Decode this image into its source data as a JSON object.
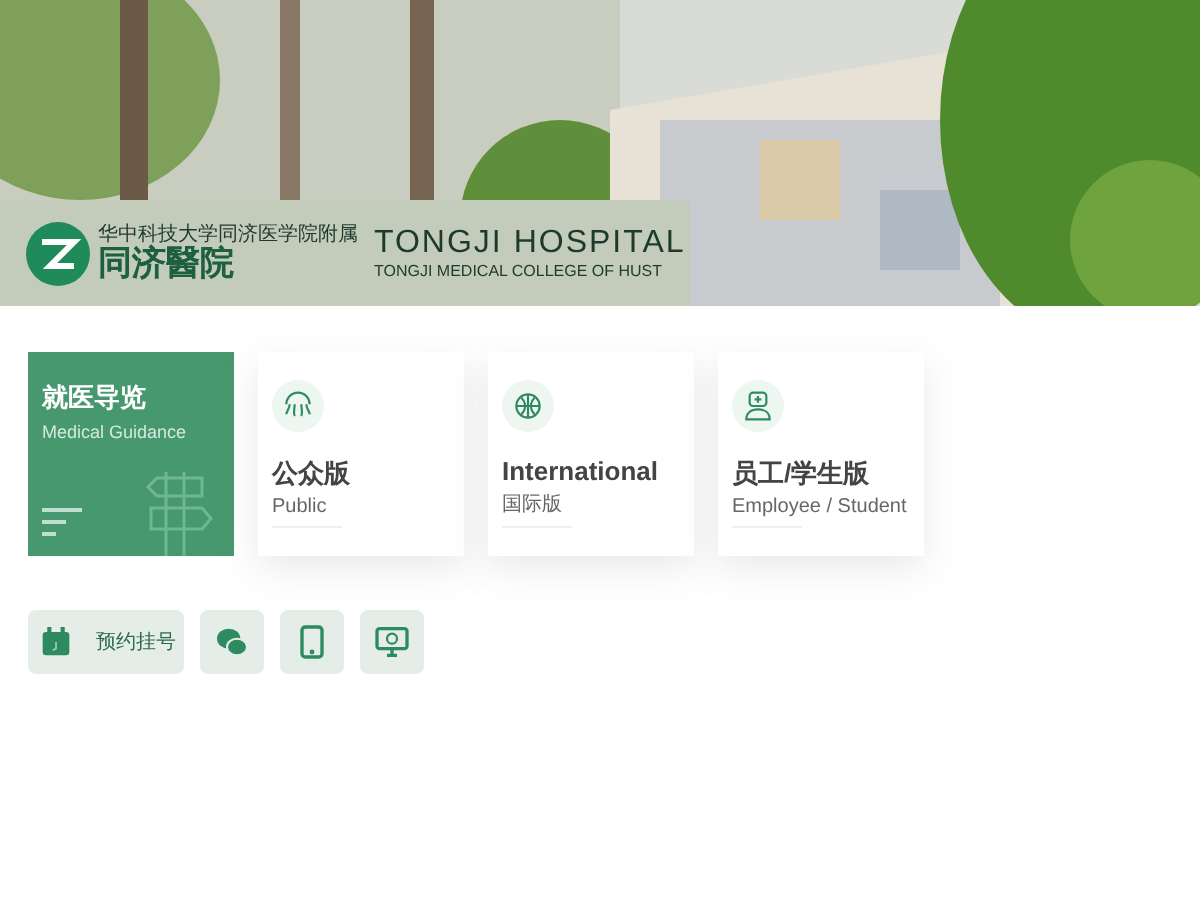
{
  "logo": {
    "affiliation": "华中科技大学同济医学院附属",
    "name_cn": "同济醫院",
    "name_en": "TONGJI HOSPITAL",
    "subtitle_en": "TONGJI MEDICAL COLLEGE OF HUST"
  },
  "cards": [
    {
      "kind": "feature",
      "title": "就医导览",
      "subtitle": "Medical Guidance"
    },
    {
      "kind": "version",
      "title": "公众版",
      "subtitle": "Public"
    },
    {
      "kind": "version",
      "title": "International",
      "subtitle": "国际版"
    },
    {
      "kind": "version",
      "title": "员工/学生版",
      "subtitle": "Employee / Student"
    }
  ],
  "quick_links": [
    {
      "kind": "labeled",
      "label": "预约挂号"
    },
    {
      "kind": "icon"
    },
    {
      "kind": "icon"
    },
    {
      "kind": "icon"
    }
  ]
}
